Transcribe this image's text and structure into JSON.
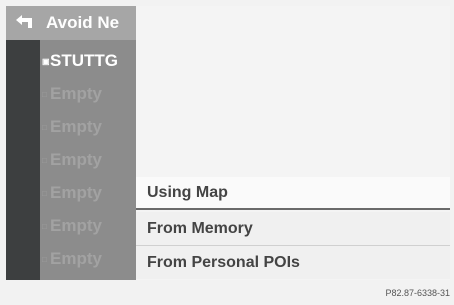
{
  "header": {
    "title": "Avoid Ne",
    "back_icon": "back-arrow-icon"
  },
  "list": {
    "items": [
      {
        "marker": "▣",
        "label": "STUTTG",
        "state": "selected"
      },
      {
        "marker": "□",
        "label": "Empty",
        "state": "empty"
      },
      {
        "marker": "□",
        "label": "Empty",
        "state": "empty"
      },
      {
        "marker": "□",
        "label": "Empty",
        "state": "empty"
      },
      {
        "marker": "□",
        "label": "Empty",
        "state": "empty"
      },
      {
        "marker": "□",
        "label": "Empty",
        "state": "empty"
      },
      {
        "marker": "□",
        "label": "Empty",
        "state": "empty"
      }
    ]
  },
  "menu": {
    "options": [
      {
        "label": "Using Map",
        "highlighted": true
      },
      {
        "label": "From Memory",
        "highlighted": false
      },
      {
        "label": "From Personal POIs",
        "highlighted": false
      }
    ]
  },
  "footer": {
    "code": "P82.87-6338-31"
  },
  "colors": {
    "screen_bg": "#f4f4f4",
    "list_bg": "#8c8c8c",
    "header_bg": "#a6a6a6",
    "strip_bg": "#3d3f40",
    "menu_text": "#444444"
  }
}
